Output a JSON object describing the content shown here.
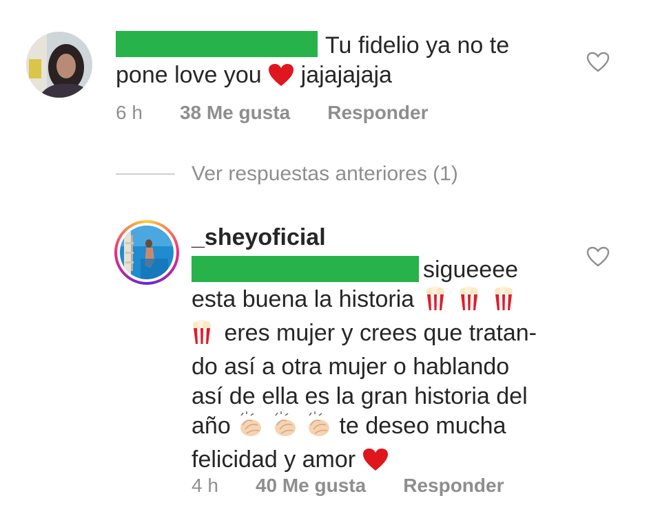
{
  "comment1": {
    "text_line1": "Tu fidelio ya no te",
    "text_line2_pre": "pone love you",
    "text_line2_post": "jajajajaja",
    "time": "6 h",
    "likes": "38 Me gusta",
    "reply_label": "Responder"
  },
  "view_replies": "Ver respuestas anteriores (1)",
  "comment2": {
    "username": "_sheyoficial",
    "line1": "sigueeee",
    "line2": "esta buena la historia",
    "line3": "eres mujer y crees que tratan-",
    "line4": "do así a otra mujer o hablando",
    "line5": "así de ella es la gran historia del",
    "line6_pre": "año",
    "line6_post": "te deseo mucha",
    "line7": "felicidad y amor",
    "time": "4 h",
    "likes": "40 Me gusta",
    "reply_label": "Responder"
  },
  "colors": {
    "redaction": "#27b24a",
    "muted": "#8e8e8e",
    "heart_red": "#e0161e"
  },
  "icons": [
    "heart-outline-icon",
    "red-heart-emoji",
    "popcorn-emoji",
    "clapping-hands-emoji"
  ]
}
